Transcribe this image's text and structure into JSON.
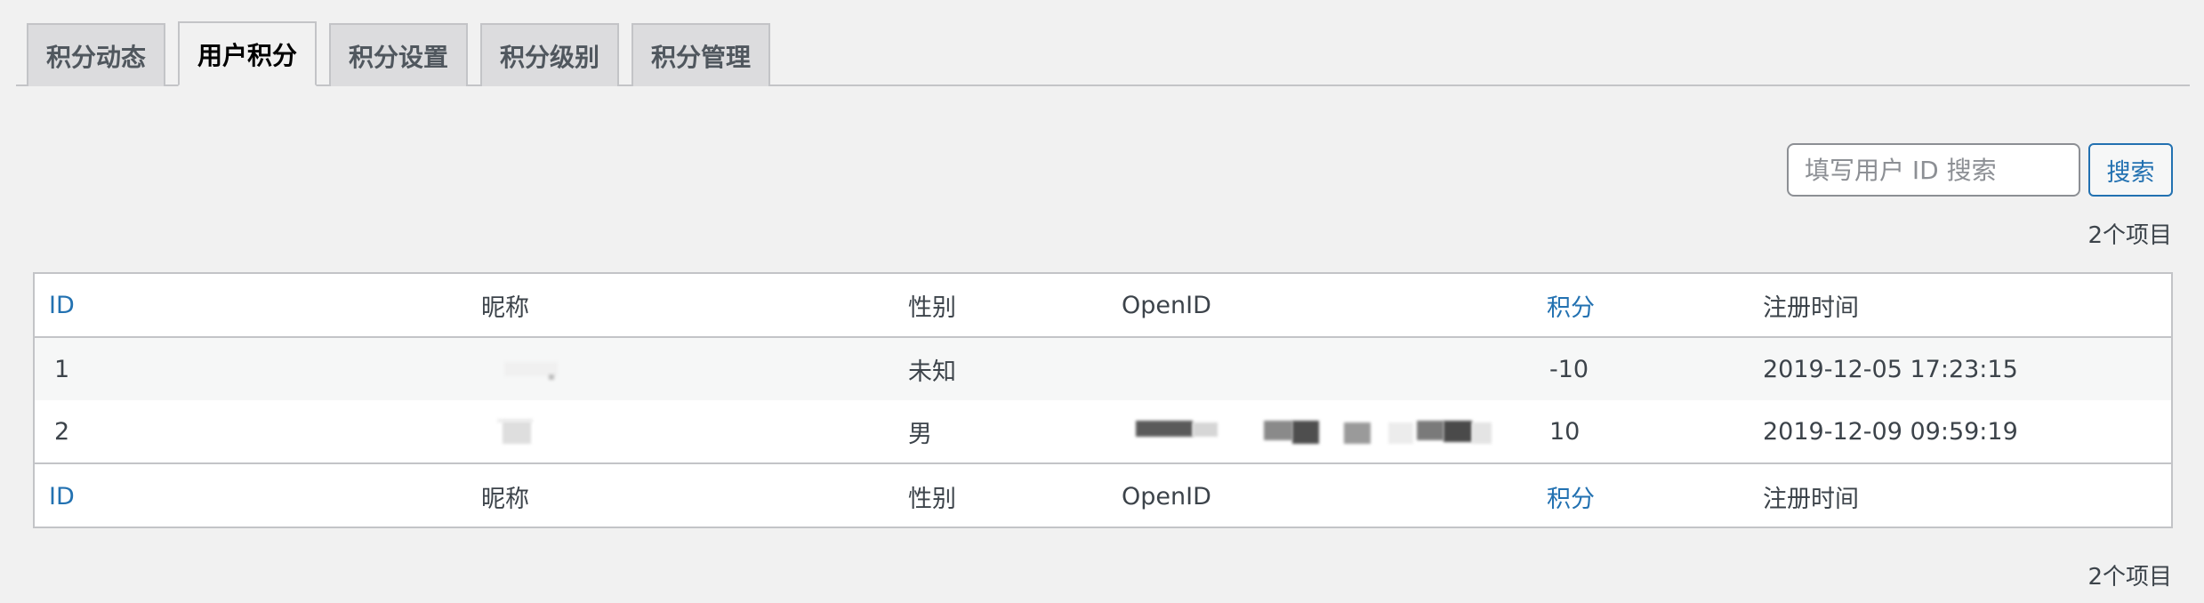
{
  "tabs": [
    {
      "label": "积分动态",
      "active": false
    },
    {
      "label": "用户积分",
      "active": true
    },
    {
      "label": "积分设置",
      "active": false
    },
    {
      "label": "积分级别",
      "active": false
    },
    {
      "label": "积分管理",
      "active": false
    }
  ],
  "search": {
    "placeholder": "填写用户 ID 搜索",
    "value": "",
    "button_label": "搜索"
  },
  "item_count": "2个项目",
  "table": {
    "columns": [
      "ID",
      "昵称",
      "性别",
      "OpenID",
      "积分",
      "注册时间"
    ],
    "rows": [
      {
        "id": "1",
        "nickname": "",
        "gender": "未知",
        "openid": "",
        "points": "-10",
        "registered": "2019-12-05 17:23:15"
      },
      {
        "id": "2",
        "nickname": "",
        "gender": "男",
        "openid": "",
        "points": "10",
        "registered": "2019-12-09 09:59:19"
      }
    ]
  },
  "colors": {
    "link": "#2271b1",
    "background": "#f1f1f1",
    "border": "#c3c4c7"
  }
}
